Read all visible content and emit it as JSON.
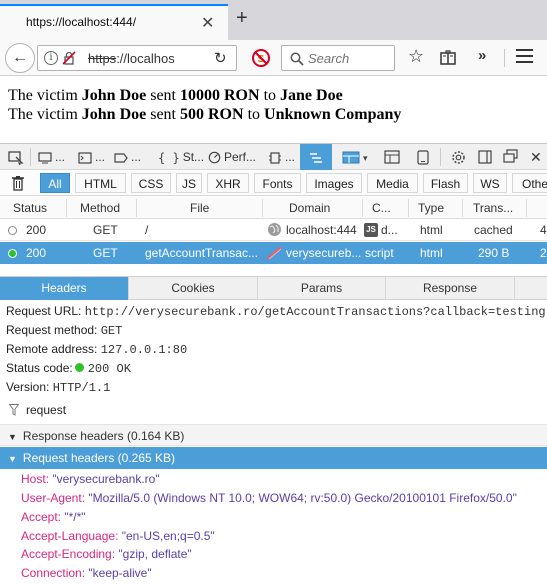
{
  "browser": {
    "tab_title": "https://localhost:444/",
    "new_tab": "+",
    "url_text": "https://localhos",
    "url_strike": "https",
    "url_rest": "://localhos",
    "search_placeholder": "Search",
    "more": "»"
  },
  "page": {
    "lines": [
      {
        "p1": "The victim ",
        "name": "John Doe",
        "p2": " sent ",
        "amount": "10000 RON",
        "p3": " to ",
        "target": "Jane Doe"
      },
      {
        "p1": "The victim ",
        "name": "John Doe",
        "p2": " sent ",
        "amount": "500 RON",
        "p3": " to ",
        "target": "Unknown Company"
      }
    ]
  },
  "devtools": {
    "tabs": {
      "inspector": "...",
      "console": "...",
      "debugger": "...",
      "style": "...",
      "scratchpad": "St...",
      "performance": "Perf...",
      "memory": "..."
    },
    "filters": [
      "All",
      "HTML",
      "CSS",
      "JS",
      "XHR",
      "Fonts",
      "Images",
      "Media",
      "Flash",
      "WS",
      "Othe"
    ],
    "columns": [
      "Status",
      "Method",
      "File",
      "Domain",
      "C...",
      "Type",
      "Trans..."
    ],
    "requests": [
      {
        "status": "200",
        "method": "GET",
        "file": "/",
        "domain": "localhost:444",
        "cause": "d...",
        "type": "html",
        "transferred": "cached",
        "extra": "4"
      },
      {
        "status": "200",
        "method": "GET",
        "file": "getAccountTransac...",
        "domain": "verysecureb...",
        "cause": "script",
        "type": "html",
        "transferred": "290 B",
        "extra": "2"
      }
    ],
    "detail_tabs": [
      "Headers",
      "Cookies",
      "Params",
      "Response"
    ],
    "details": {
      "request_url_label": "Request URL:",
      "request_url": "http://verysecurebank.ro/getAccountTransactions?callback=testing",
      "method_label": "Request method:",
      "method": "GET",
      "remote_label": "Remote address:",
      "remote": "127.0.0.1:80",
      "status_label": "Status code:",
      "status": "200 OK",
      "version_label": "Version:",
      "version": "HTTP/1.1",
      "filter_value": "request",
      "response_headers": "Response headers (0.164 KB)",
      "request_headers": "Request headers (0.265 KB)",
      "headers": [
        {
          "key": "Host:",
          "value": "\"verysecurebank.ro\""
        },
        {
          "key": "User-Agent:",
          "value": "\"Mozilla/5.0 (Windows NT 10.0; WOW64; rv:50.0) Gecko/20100101 Firefox/50.0\""
        },
        {
          "key": "Accept:",
          "value": "\"*/*\""
        },
        {
          "key": "Accept-Language:",
          "value": "\"en-US,en;q=0.5\""
        },
        {
          "key": "Accept-Encoding:",
          "value": "\"gzip, deflate\""
        },
        {
          "key": "Connection:",
          "value": "\"keep-alive\""
        }
      ]
    }
  },
  "colors": {
    "accent": "#4c9ed9",
    "status_ok": "#2fbf2f",
    "header_key": "#d7267e",
    "header_value": "#5a40a8"
  }
}
